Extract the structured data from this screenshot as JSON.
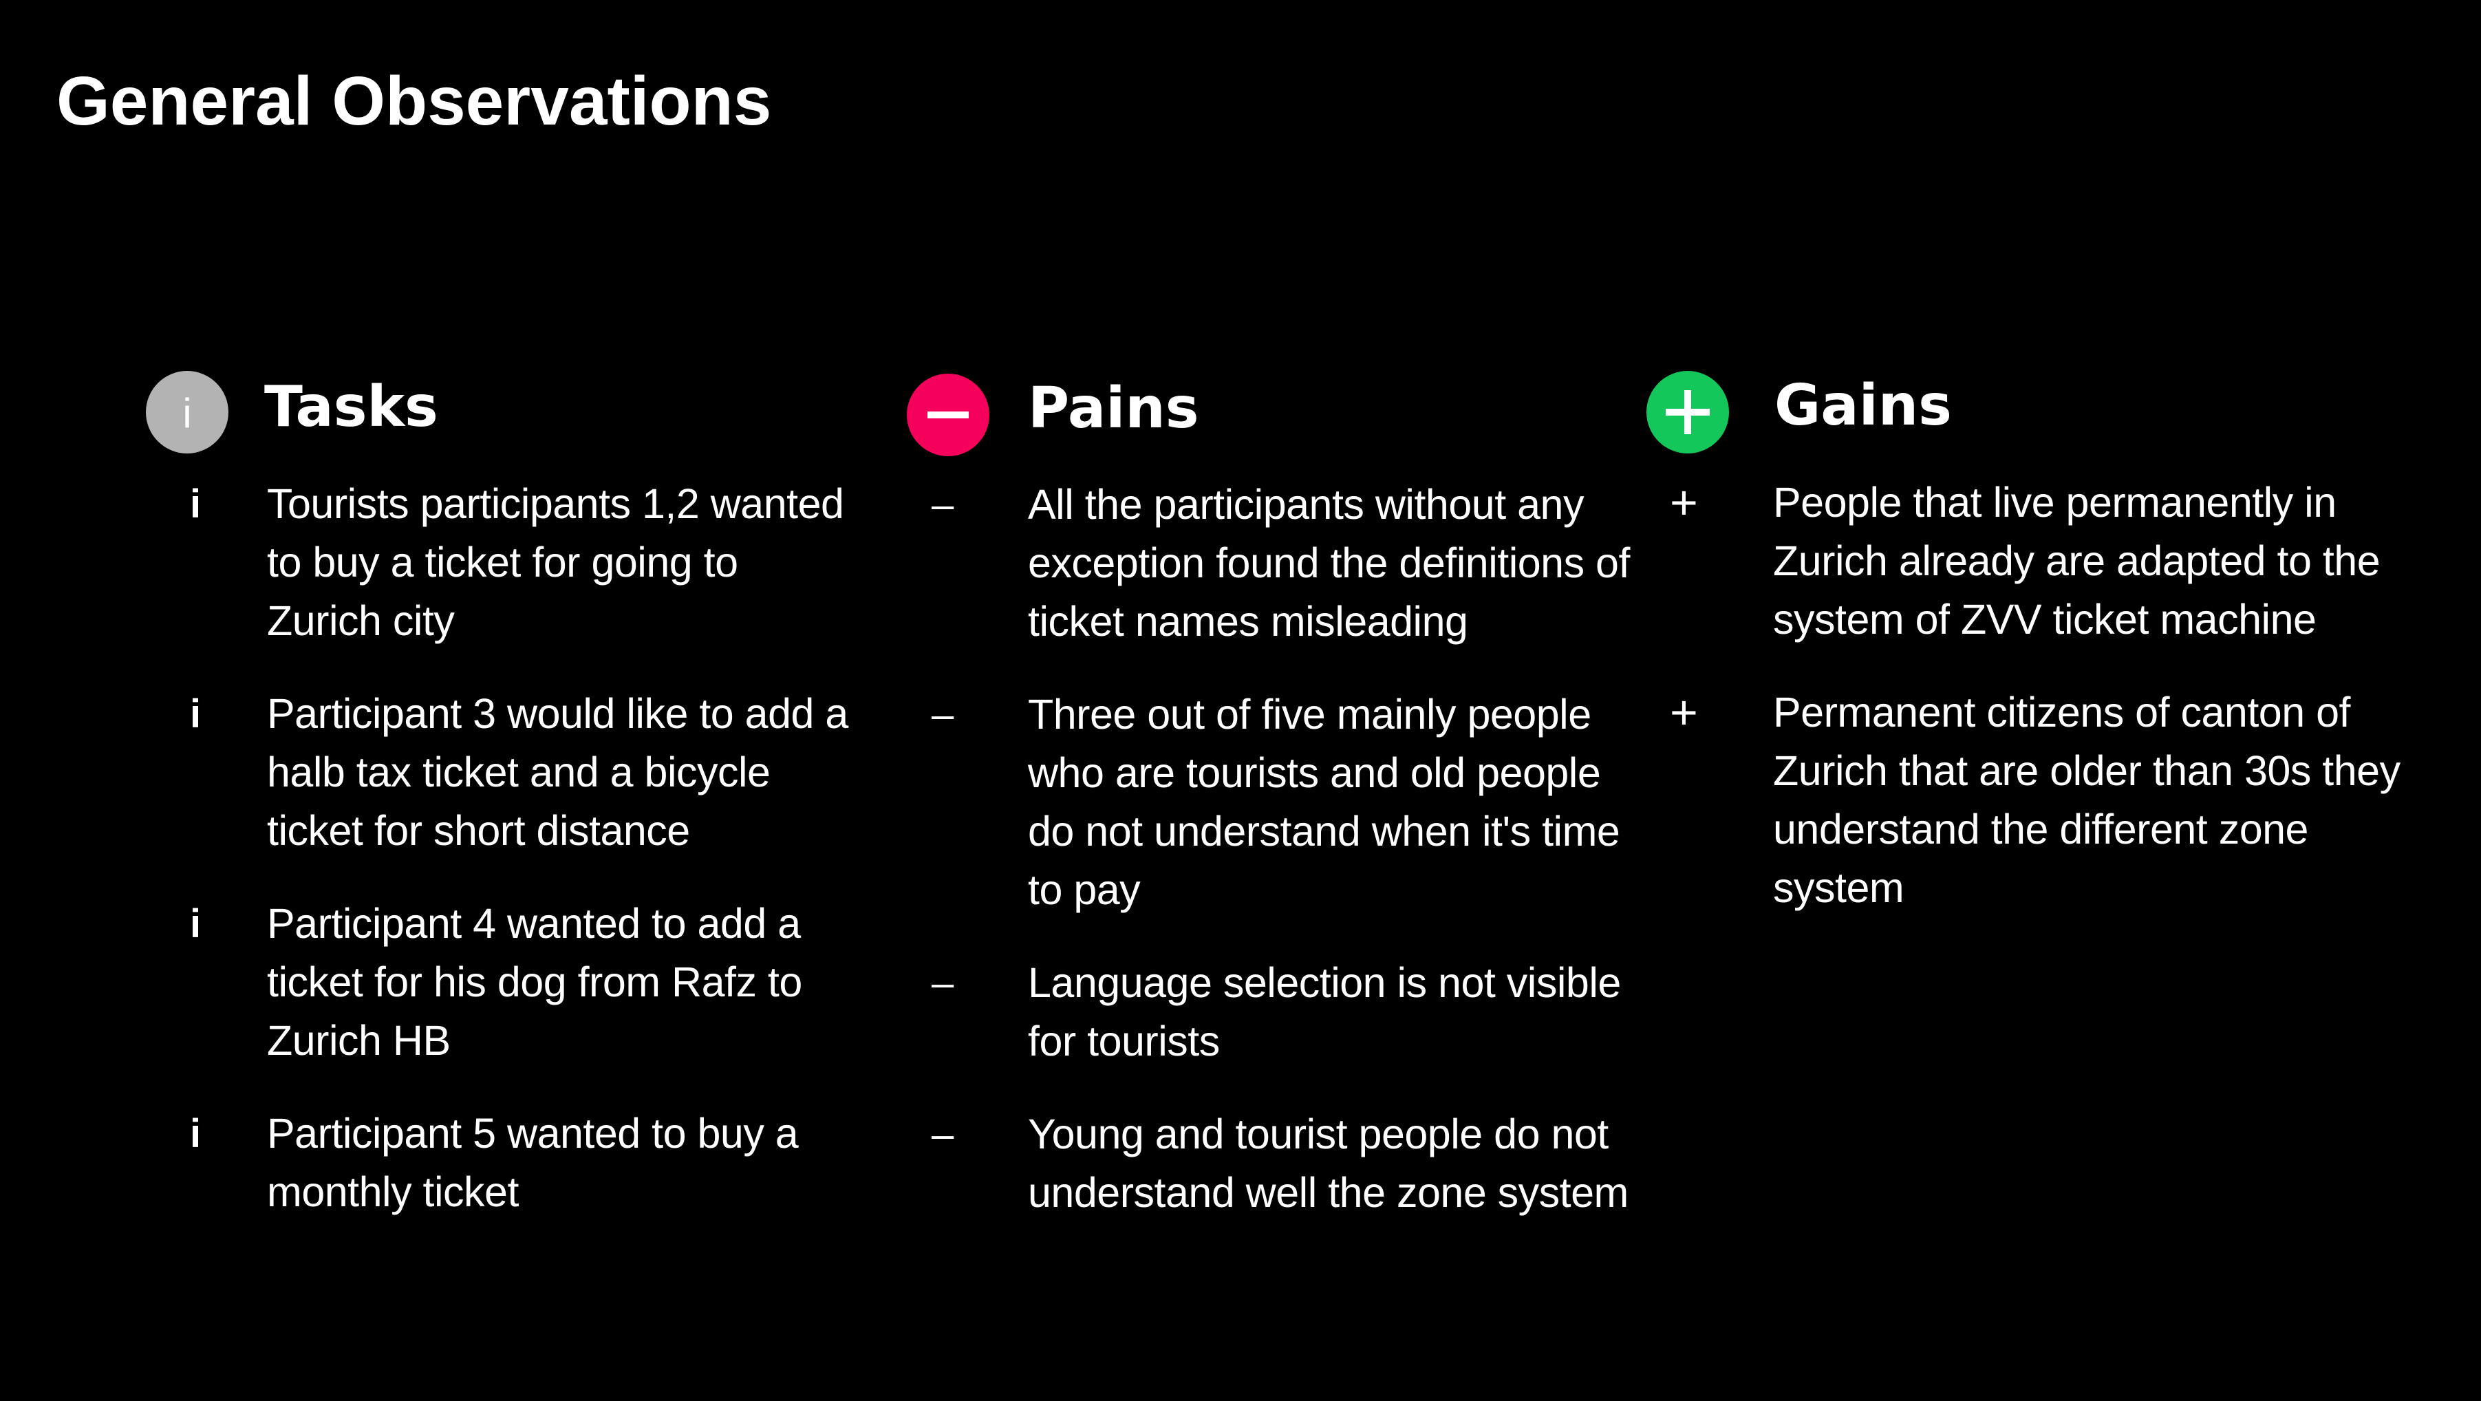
{
  "slide": {
    "title": "General Observations"
  },
  "colors": {
    "background": "#000000",
    "text": "#ffffff",
    "tasks_accent": "#b3b3b3",
    "pains_accent": "#f5005a",
    "gains_accent": "#14c75a"
  },
  "tasks": {
    "heading": "Tasks",
    "icon": "info-icon",
    "icon_glyph": "i",
    "bullet": "i",
    "items": [
      "Tourists participants 1,2 wanted to buy a ticket for going to Zurich city",
      "Participant 3 would like to add a halb tax ticket and a bicycle ticket for short distance",
      "Participant 4 wanted to add a ticket for his dog from Rafz to Zurich HB",
      "Participant 5 wanted to buy a monthly ticket"
    ]
  },
  "pains": {
    "heading": "Pains",
    "icon": "minus-icon",
    "bullet": "–",
    "items": [
      "All the participants without any exception found the definitions of ticket names misleading",
      "Three out of five mainly people who are tourists and old people do not understand when it's time to pay",
      "Language selection is not visible for tourists",
      "Young and tourist people do not understand well the zone system"
    ]
  },
  "gains": {
    "heading": "Gains",
    "icon": "plus-icon",
    "bullet": "+",
    "items": [
      "People that live permanently in Zurich  already are adapted to the system of ZVV  ticket machine",
      "Permanent citizens of canton of Zurich that are older than 30s they understand the different zone system"
    ]
  }
}
